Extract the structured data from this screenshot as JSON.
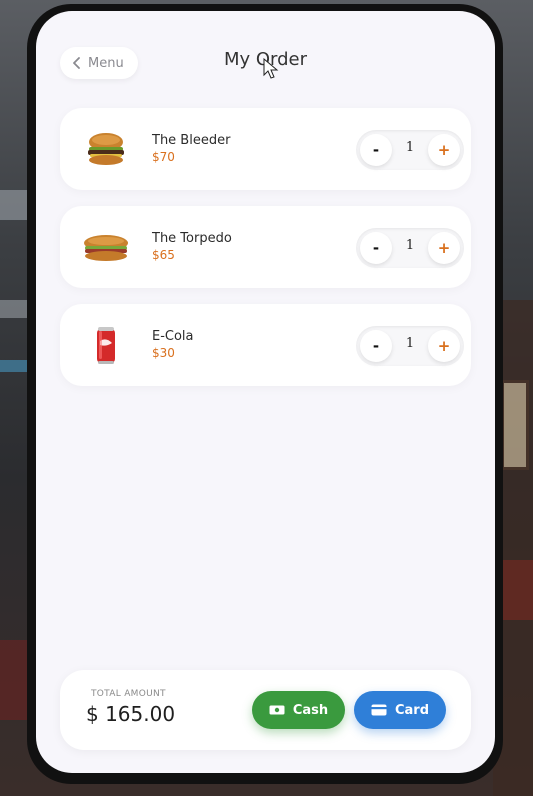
{
  "header": {
    "back_label": "Menu",
    "title": "My Order"
  },
  "order": {
    "items": [
      {
        "name": "The Bleeder",
        "price": "$70",
        "quantity": "1",
        "minus_label": "-",
        "plus_label": "+",
        "icon": "burger-icon"
      },
      {
        "name": "The Torpedo",
        "price": "$65",
        "quantity": "1",
        "minus_label": "-",
        "plus_label": "+",
        "icon": "sub-sandwich-icon"
      },
      {
        "name": "E-Cola",
        "price": "$30",
        "quantity": "1",
        "minus_label": "-",
        "plus_label": "+",
        "icon": "soda-can-icon"
      }
    ]
  },
  "footer": {
    "total_label": "TOTAL AMOUNT",
    "total_value": "$ 165.00",
    "cash_label": "Cash",
    "card_label": "Card"
  },
  "colors": {
    "price": "#d9701e",
    "cash": "#3a9a3e",
    "card": "#2f7fd8",
    "panel_bg": "#f7f6fb"
  }
}
